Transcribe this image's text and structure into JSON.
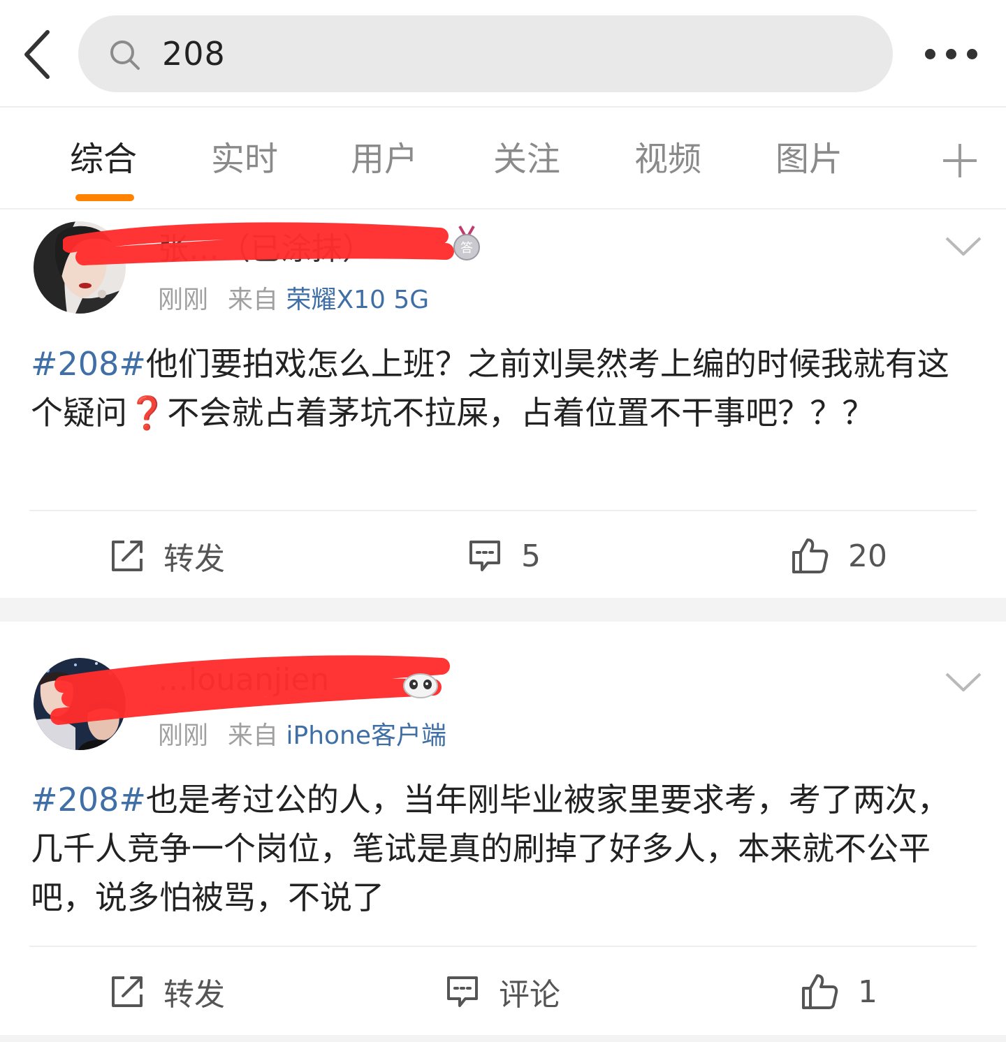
{
  "search": {
    "query": "208"
  },
  "tabs": [
    {
      "label": "综合"
    },
    {
      "label": "实时"
    },
    {
      "label": "用户"
    },
    {
      "label": "关注"
    },
    {
      "label": "视频"
    },
    {
      "label": "图片"
    }
  ],
  "posts": [
    {
      "username": "张…（已涂抹）",
      "time": "刚刚",
      "from_prefix": "来自",
      "source": "荣耀X10 5G",
      "hashtag": "#208#",
      "text": "他们要拍戏怎么上班？之前刘昊然考上编的时候我就有这个疑问❓不会就占着茅坑不拉屎，占着位置不干事吧？？？",
      "repost_label": "转发",
      "comment_label": "5",
      "like_label": "20"
    },
    {
      "username": "…louanjien",
      "time": "刚刚",
      "from_prefix": "来自",
      "source": "iPhone客户端",
      "hashtag": "#208#",
      "text": "也是考过公的人，当年刚毕业被家里要求考，考了两次，几千人竞争一个岗位，笔试是真的刷掉了好多人，本来就不公平吧，说多怕被骂，不说了",
      "repost_label": "转发",
      "comment_label": "评论",
      "like_label": "1"
    }
  ],
  "colors": {
    "accent": "#ff8200",
    "link": "#3f6fa6",
    "redaction": "#ff2d2d"
  },
  "icons": [
    "back-icon",
    "search-icon",
    "more-icon",
    "plus-icon",
    "chevron-down-icon",
    "repost-icon",
    "comment-icon",
    "like-icon",
    "medal-icon",
    "panda-icon"
  ]
}
